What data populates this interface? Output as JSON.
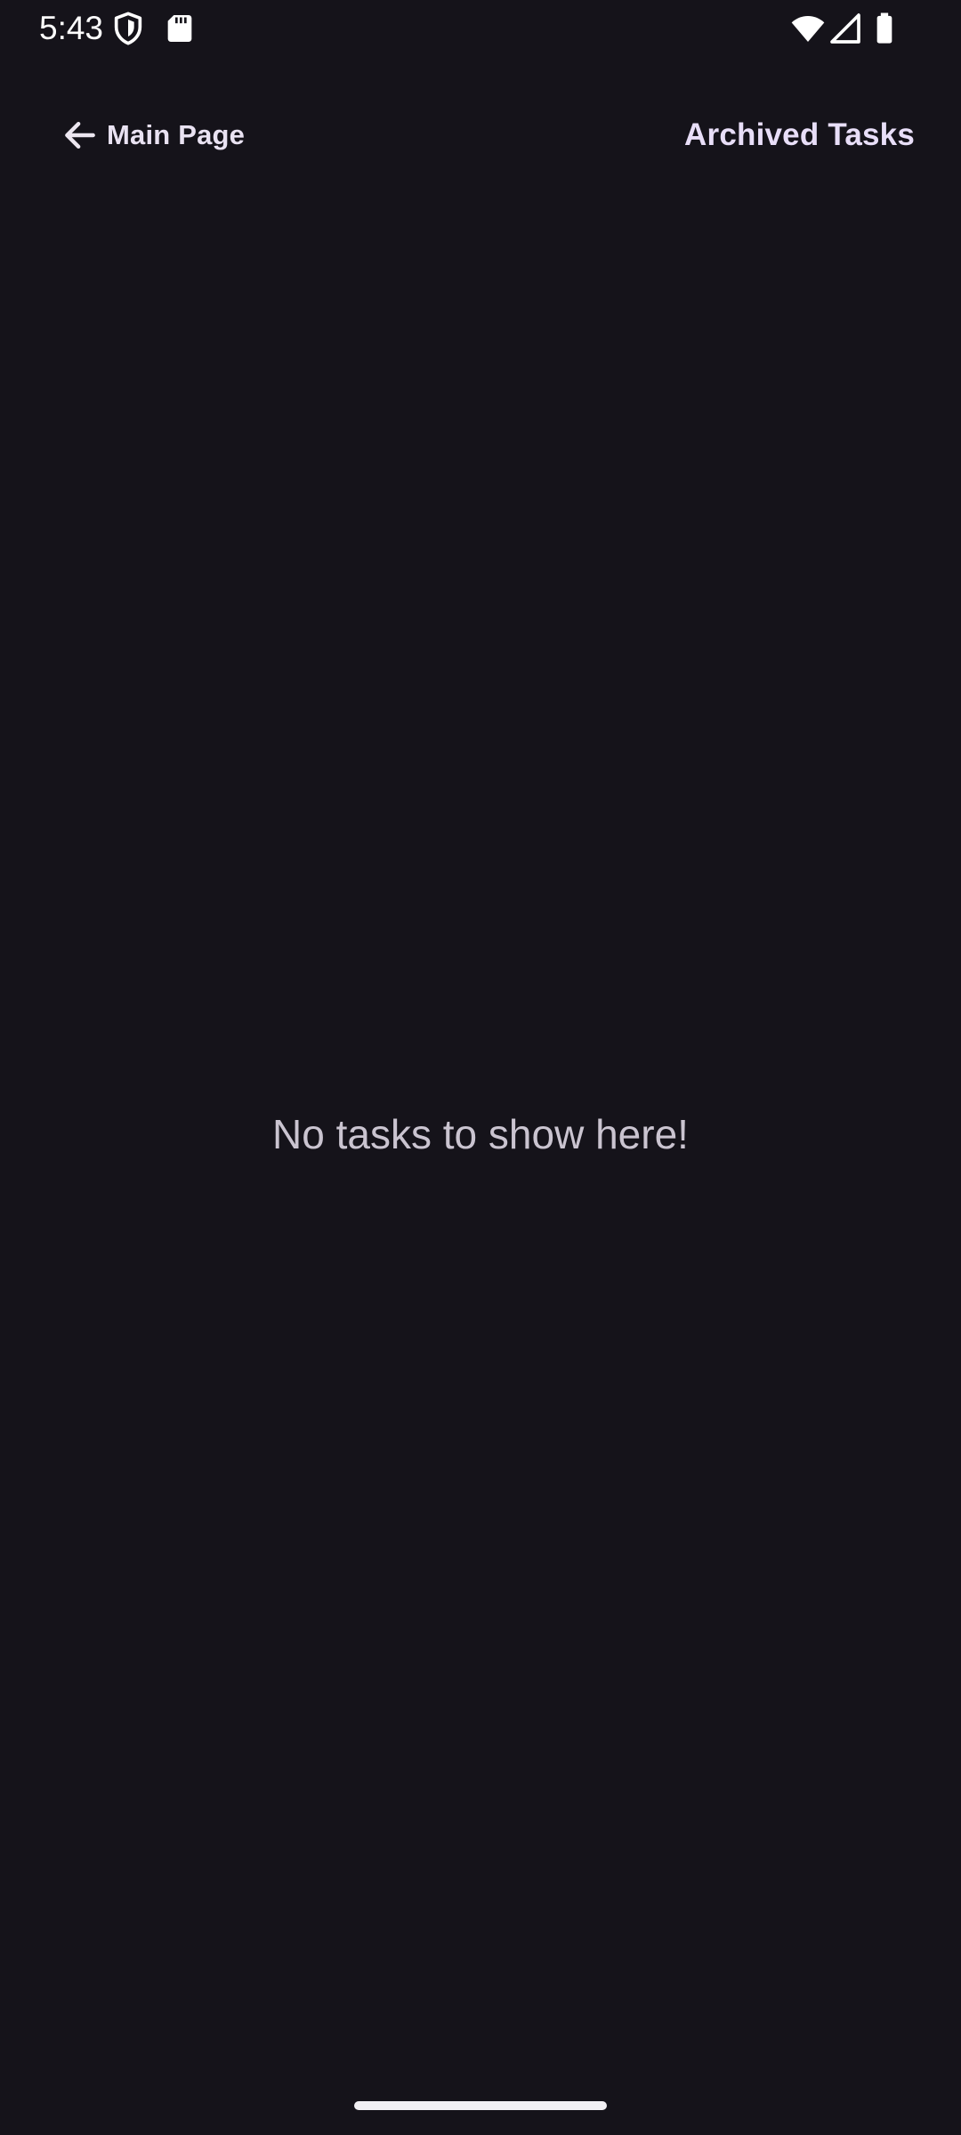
{
  "status_bar": {
    "time": "5:43",
    "icons": [
      "shield-icon",
      "sd-card-icon",
      "wifi-icon",
      "cell-signal-icon",
      "battery-icon"
    ]
  },
  "top_bar": {
    "back_label": "Main Page",
    "title": "Archived Tasks"
  },
  "empty_state": {
    "message": "No tasks to show here!"
  },
  "colors": {
    "background": "#15131a",
    "title": "#e8def8",
    "text_primary": "#e9e2f2",
    "text_secondary": "#cac4d0"
  }
}
